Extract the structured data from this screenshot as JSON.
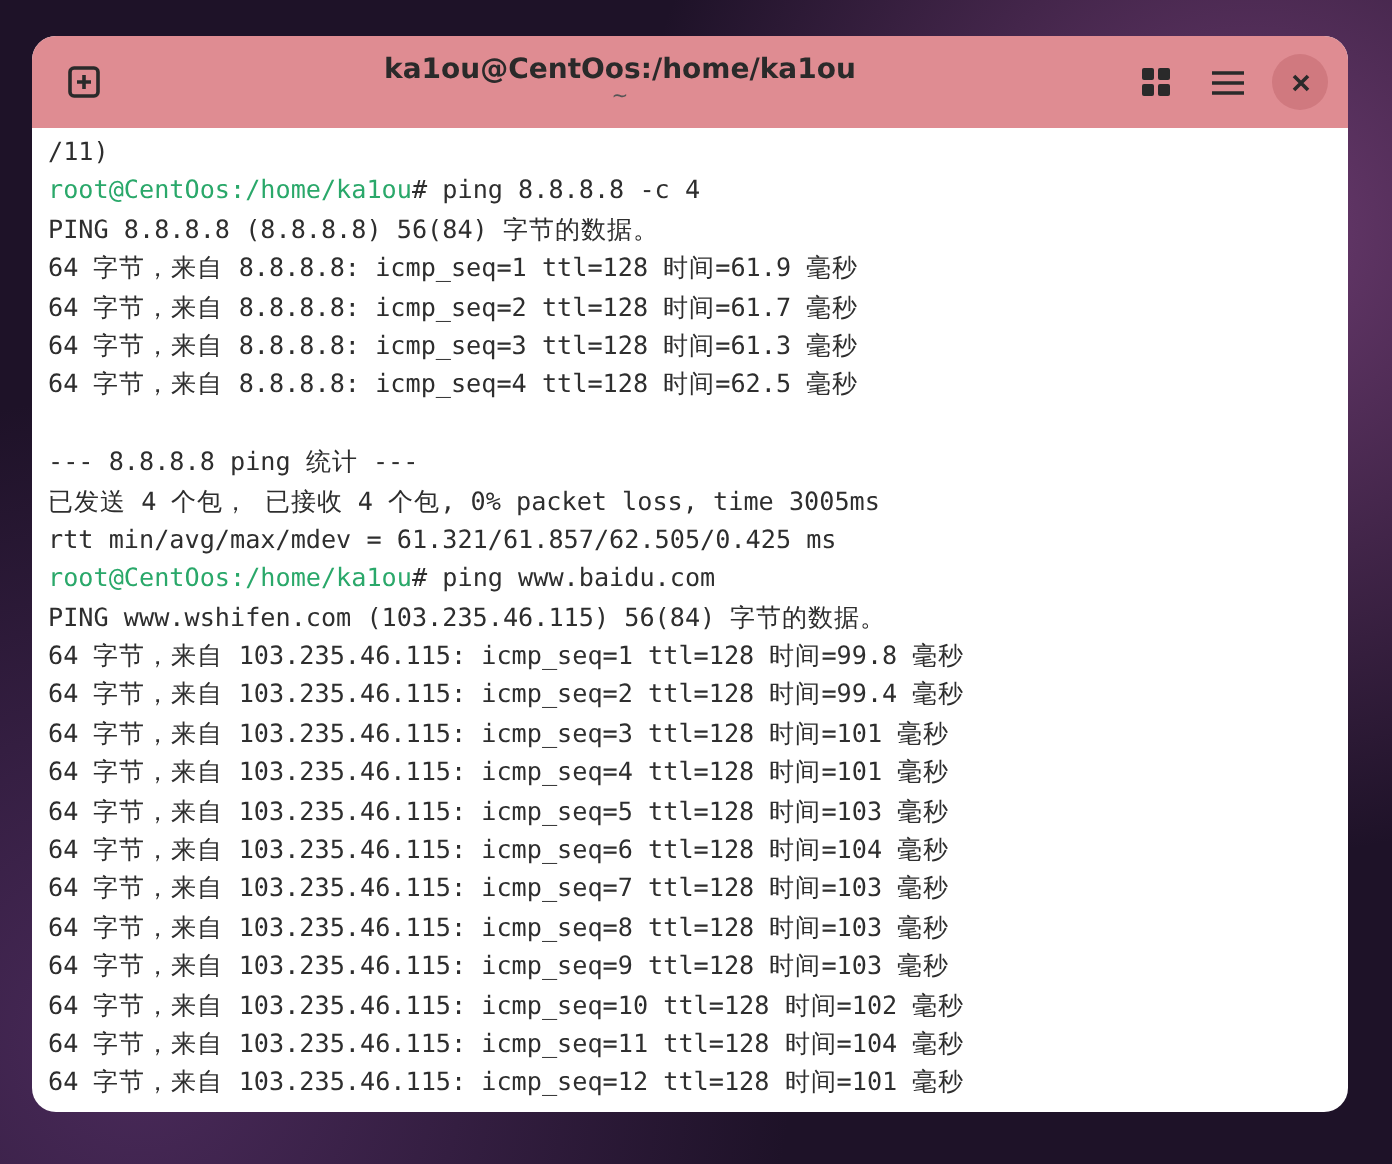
{
  "window": {
    "title": "ka1ou@CentOos:/home/ka1ou",
    "subtitle": "~"
  },
  "terminal": {
    "lines": [
      {
        "kind": "output",
        "text": "/11)"
      },
      {
        "kind": "prompt",
        "prompt": "root@CentOos:/home/ka1ou",
        "command": "# ping 8.8.8.8 -c 4"
      },
      {
        "kind": "output",
        "text": "PING 8.8.8.8 (8.8.8.8) 56(84) 字节的数据。"
      },
      {
        "kind": "output",
        "text": "64 字节，来自 8.8.8.8: icmp_seq=1 ttl=128 时间=61.9 毫秒"
      },
      {
        "kind": "output",
        "text": "64 字节，来自 8.8.8.8: icmp_seq=2 ttl=128 时间=61.7 毫秒"
      },
      {
        "kind": "output",
        "text": "64 字节，来自 8.8.8.8: icmp_seq=3 ttl=128 时间=61.3 毫秒"
      },
      {
        "kind": "output",
        "text": "64 字节，来自 8.8.8.8: icmp_seq=4 ttl=128 时间=62.5 毫秒"
      },
      {
        "kind": "blank"
      },
      {
        "kind": "output",
        "text": "--- 8.8.8.8 ping 统计 ---"
      },
      {
        "kind": "output",
        "text": "已发送 4 个包， 已接收 4 个包, 0% packet loss, time 3005ms"
      },
      {
        "kind": "output",
        "text": "rtt min/avg/max/mdev = 61.321/61.857/62.505/0.425 ms"
      },
      {
        "kind": "prompt",
        "prompt": "root@CentOos:/home/ka1ou",
        "command": "# ping www.baidu.com"
      },
      {
        "kind": "output",
        "text": "PING www.wshifen.com (103.235.46.115) 56(84) 字节的数据。"
      },
      {
        "kind": "output",
        "text": "64 字节，来自 103.235.46.115: icmp_seq=1 ttl=128 时间=99.8 毫秒"
      },
      {
        "kind": "output",
        "text": "64 字节，来自 103.235.46.115: icmp_seq=2 ttl=128 时间=99.4 毫秒"
      },
      {
        "kind": "output",
        "text": "64 字节，来自 103.235.46.115: icmp_seq=3 ttl=128 时间=101 毫秒"
      },
      {
        "kind": "output",
        "text": "64 字节，来自 103.235.46.115: icmp_seq=4 ttl=128 时间=101 毫秒"
      },
      {
        "kind": "output",
        "text": "64 字节，来自 103.235.46.115: icmp_seq=5 ttl=128 时间=103 毫秒"
      },
      {
        "kind": "output",
        "text": "64 字节，来自 103.235.46.115: icmp_seq=6 ttl=128 时间=104 毫秒"
      },
      {
        "kind": "output",
        "text": "64 字节，来自 103.235.46.115: icmp_seq=7 ttl=128 时间=103 毫秒"
      },
      {
        "kind": "output",
        "text": "64 字节，来自 103.235.46.115: icmp_seq=8 ttl=128 时间=103 毫秒"
      },
      {
        "kind": "output",
        "text": "64 字节，来自 103.235.46.115: icmp_seq=9 ttl=128 时间=103 毫秒"
      },
      {
        "kind": "output",
        "text": "64 字节，来自 103.235.46.115: icmp_seq=10 ttl=128 时间=102 毫秒"
      },
      {
        "kind": "output",
        "text": "64 字节，来自 103.235.46.115: icmp_seq=11 ttl=128 时间=104 毫秒"
      },
      {
        "kind": "output",
        "text": "64 字节，来自 103.235.46.115: icmp_seq=12 ttl=128 时间=101 毫秒"
      }
    ]
  }
}
